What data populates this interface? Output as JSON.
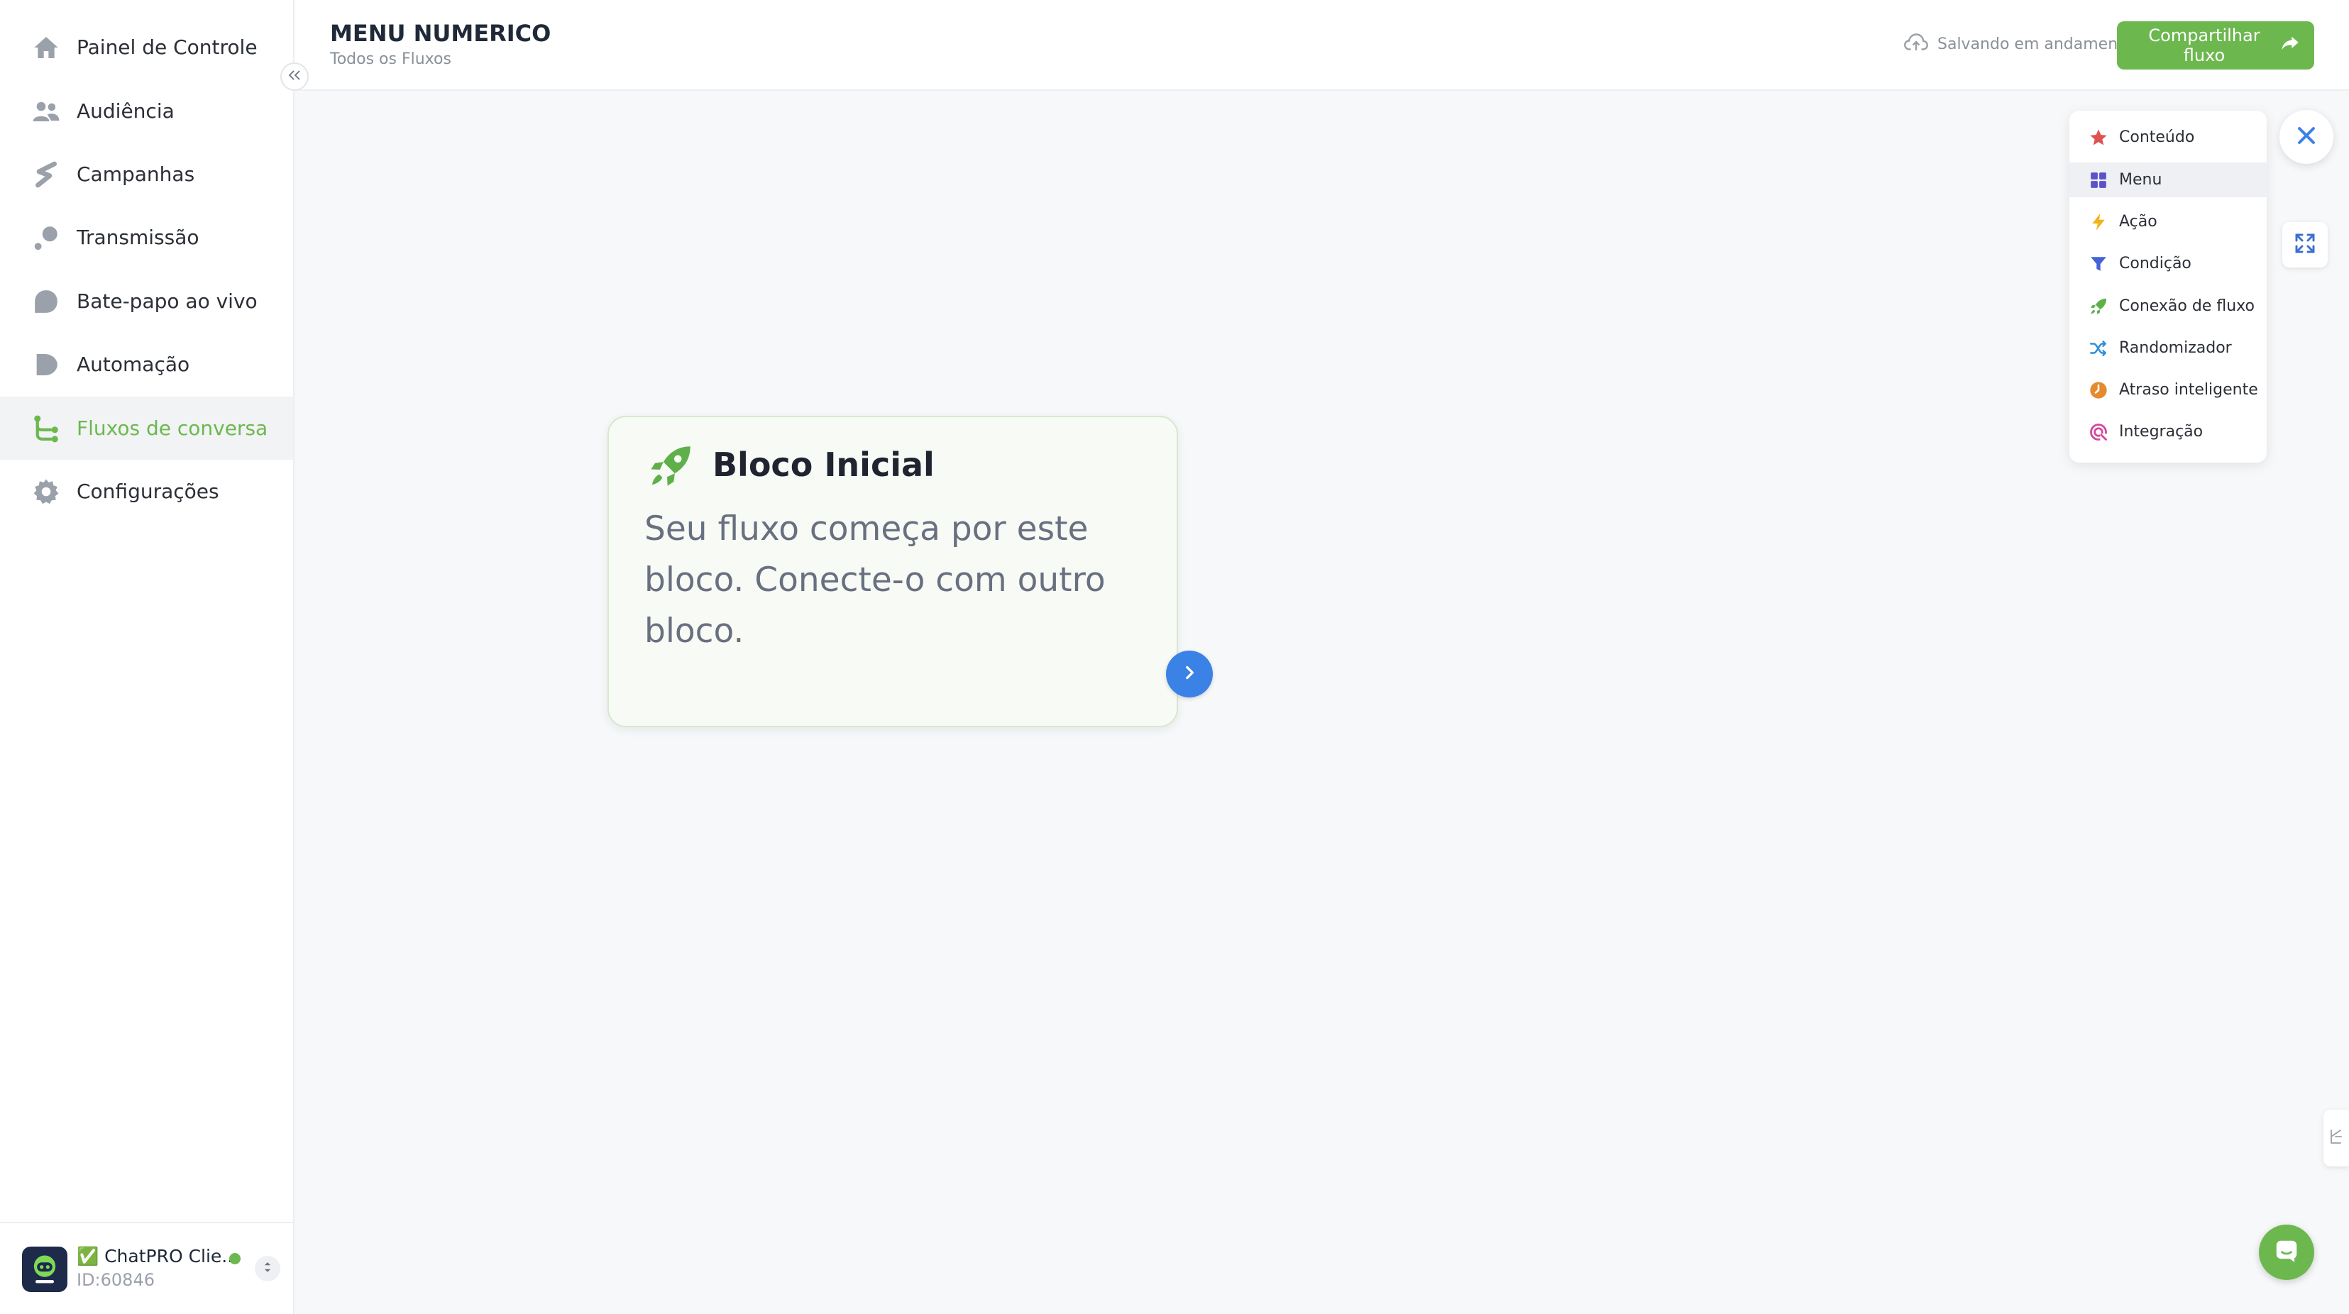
{
  "sidebar": {
    "items": [
      {
        "label": "Painel de Controle",
        "icon": "home-icon"
      },
      {
        "label": "Audiência",
        "icon": "users-icon"
      },
      {
        "label": "Campanhas",
        "icon": "campaign-icon"
      },
      {
        "label": "Transmissão",
        "icon": "broadcast-icon"
      },
      {
        "label": "Bate-papo ao vivo",
        "icon": "chat-bubble-icon"
      },
      {
        "label": "Automação",
        "icon": "play-icon"
      },
      {
        "label": "Fluxos de conversa",
        "icon": "flow-icon",
        "active": true
      },
      {
        "label": "Configurações",
        "icon": "gear-icon"
      }
    ],
    "account": {
      "name": "✅ ChatPRO Clie...",
      "id": "ID:60846",
      "status_color": "#6cb84f"
    }
  },
  "header": {
    "title": "MENU NUMERICO",
    "breadcrumb": "Todos os Fluxos",
    "save_status": "Salvando em andamento",
    "share_label": "Compartilhar fluxo"
  },
  "canvas": {
    "start_block": {
      "title": "Bloco Inicial",
      "description": "Seu fluxo começa por este bloco. Conecte-o com outro bloco."
    }
  },
  "block_menu": {
    "items": [
      {
        "label": "Conteúdo",
        "icon": "star-icon",
        "color": "#e05252"
      },
      {
        "label": "Menu",
        "icon": "grid-icon",
        "color": "#5b52c9"
      },
      {
        "label": "Ação",
        "icon": "bolt-icon",
        "color": "#f2b21b"
      },
      {
        "label": "Condição",
        "icon": "funnel-icon",
        "color": "#4461d8"
      },
      {
        "label": "Conexão de fluxo",
        "icon": "rocket-icon",
        "color": "#5fb04a"
      },
      {
        "label": "Randomizador",
        "icon": "shuffle-icon",
        "color": "#2f8fd8"
      },
      {
        "label": "Atraso inteligente",
        "icon": "clock-icon",
        "color": "#e58a2e"
      },
      {
        "label": "Integração",
        "icon": "integration-icon",
        "color": "#d6479c"
      }
    ]
  },
  "colors": {
    "accent": "#6cb84f",
    "primary_blue": "#3b82e6"
  }
}
